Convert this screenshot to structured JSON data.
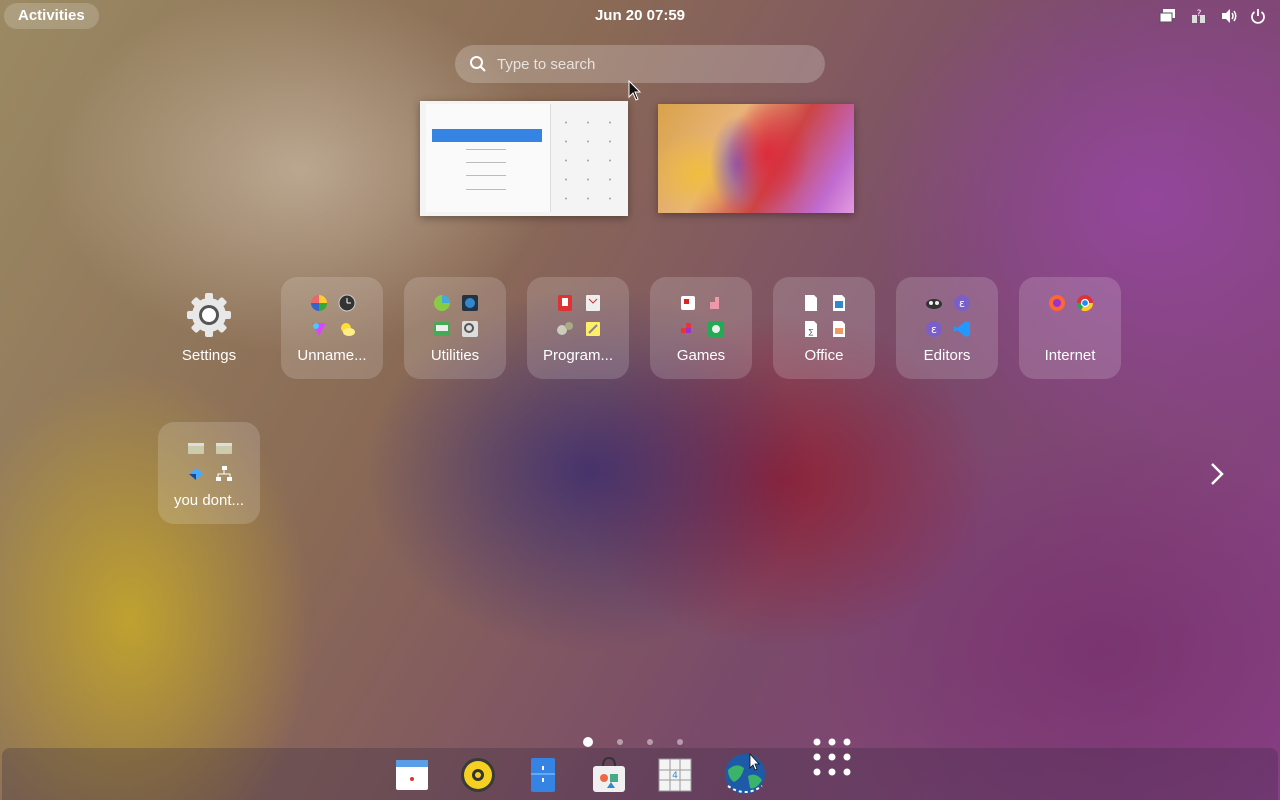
{
  "topbar": {
    "activities_label": "Activities",
    "clock": "Jun 20  07:59",
    "tray_icons": [
      "screen-share-icon",
      "network-icon",
      "volume-icon",
      "power-icon"
    ]
  },
  "search": {
    "placeholder": "Type to search"
  },
  "apps": [
    {
      "label": "Settings",
      "icon": "gear-icon"
    },
    {
      "label": "Unname...",
      "icons": [
        "color-icon",
        "clock-icon",
        "shapes-icon",
        "weather-icon"
      ]
    },
    {
      "label": "Utilities",
      "icons": [
        "disk-usage-icon",
        "screenshot-icon",
        "terminal-icon",
        "inspect-icon"
      ]
    },
    {
      "label": "Program...",
      "icons": [
        "ruby-icon",
        "devhelp-icon",
        "gears-icon",
        "notes-icon"
      ]
    },
    {
      "label": "Games",
      "icons": [
        "cards-icon",
        "puzzle-icon",
        "tetris-icon",
        "mines-icon"
      ]
    },
    {
      "label": "Office",
      "icons": [
        "doc-icon",
        "writer-icon",
        "math-icon",
        "draw-icon"
      ]
    },
    {
      "label": "Editors",
      "icons": [
        "vim-icon",
        "emacs-icon",
        "emacs2-icon",
        "vscode-icon"
      ]
    },
    {
      "label": "Internet",
      "icons": [
        "firefox-icon",
        "chrome-icon"
      ]
    },
    {
      "label": "you dont...",
      "icons": [
        "folder-icon",
        "folder2-icon",
        "vm-icon",
        "network-tree-icon"
      ]
    }
  ],
  "pagination": {
    "pages": 4,
    "current": 1
  },
  "dock": [
    "calendar-icon",
    "rhythmbox-icon",
    "files-icon",
    "software-store-icon",
    "sudoku-icon",
    "globe-icon"
  ],
  "colors": {
    "accent": "#3584e4",
    "folder_bg": "rgba(255,255,255,0.16)"
  }
}
